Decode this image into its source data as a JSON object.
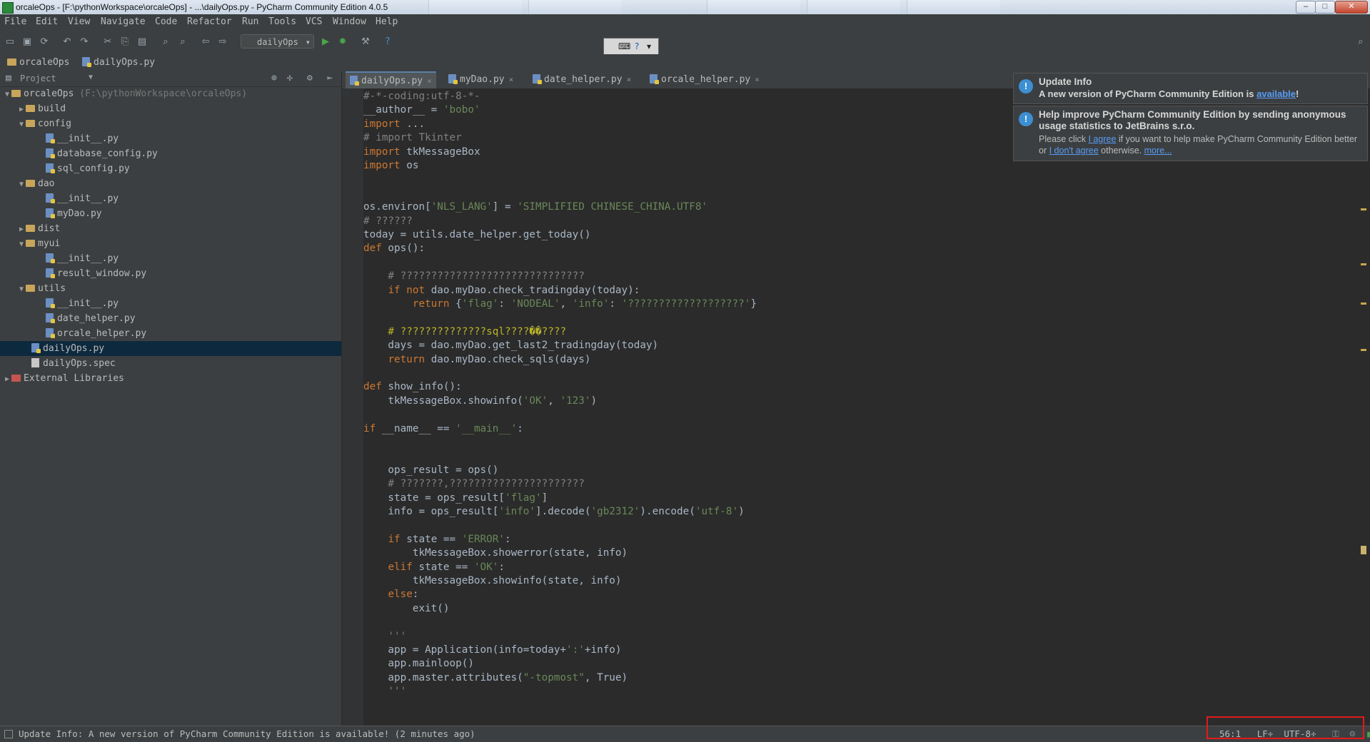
{
  "window": {
    "title": "orcaleOps - [F:\\pythonWorkspace\\orcaleOps] - ...\\dailyOps.py - PyCharm Community Edition 4.0.5",
    "controls": {
      "minimize": "–",
      "maximize": "□",
      "close": "✕"
    }
  },
  "menu": [
    "File",
    "Edit",
    "View",
    "Navigate",
    "Code",
    "Refactor",
    "Run",
    "Tools",
    "VCS",
    "Window",
    "Help"
  ],
  "toolbar": {
    "run_config": "dailyOps",
    "icons": [
      "open-icon",
      "save-icon",
      "sync-icon",
      "undo-icon",
      "redo-icon",
      "cut-icon",
      "copy-icon",
      "paste-icon",
      "find-icon",
      "replace-icon",
      "back-icon",
      "forward-icon",
      "run-icon",
      "debug-icon",
      "settings-icon",
      "help-icon"
    ],
    "search_icon": "search-icon"
  },
  "breadcrumb": [
    "orcaleOps",
    "dailyOps.py"
  ],
  "project_panel": {
    "header": "Project",
    "tree": [
      {
        "label": "orcaleOps",
        "path": "(F:\\pythonWorkspace\\orcaleOps)",
        "type": "folder",
        "level": 0,
        "toggle": "▼"
      },
      {
        "label": "build",
        "type": "folder",
        "level": 1,
        "toggle": "▶"
      },
      {
        "label": "config",
        "type": "folder",
        "level": 1,
        "toggle": "▼"
      },
      {
        "label": "__init__.py",
        "type": "py",
        "level": 2
      },
      {
        "label": "database_config.py",
        "type": "py",
        "level": 2
      },
      {
        "label": "sql_config.py",
        "type": "py",
        "level": 2
      },
      {
        "label": "dao",
        "type": "folder",
        "level": 1,
        "toggle": "▼"
      },
      {
        "label": "__init__.py",
        "type": "py",
        "level": 2
      },
      {
        "label": "myDao.py",
        "type": "py",
        "level": 2
      },
      {
        "label": "dist",
        "type": "folder",
        "level": 1,
        "toggle": "▶"
      },
      {
        "label": "myui",
        "type": "folder",
        "level": 1,
        "toggle": "▼"
      },
      {
        "label": "__init__.py",
        "type": "py",
        "level": 2
      },
      {
        "label": "result_window.py",
        "type": "py",
        "level": 2
      },
      {
        "label": "utils",
        "type": "folder",
        "level": 1,
        "toggle": "▼"
      },
      {
        "label": "__init__.py",
        "type": "py",
        "level": 2
      },
      {
        "label": "date_helper.py",
        "type": "py",
        "level": 2
      },
      {
        "label": "orcale_helper.py",
        "type": "py",
        "level": 2
      },
      {
        "label": "dailyOps.py",
        "type": "py",
        "level": 1,
        "selected": true
      },
      {
        "label": "dailyOps.spec",
        "type": "spec",
        "level": 1
      },
      {
        "label": "External Libraries",
        "type": "lib",
        "level": 0,
        "toggle": "▶"
      }
    ]
  },
  "editor_tabs": [
    {
      "label": "dailyOps.py",
      "active": true
    },
    {
      "label": "myDao.py"
    },
    {
      "label": "date_helper.py"
    },
    {
      "label": "orcale_helper.py"
    }
  ],
  "code_lines": [
    "#-*-coding:utf-8-*-",
    "__author__ = 'bobo'",
    "import ...",
    "# import Tkinter",
    "import tkMessageBox",
    "import os",
    "",
    "",
    "os.environ['NLS_LANG'] = 'SIMPLIFIED CHINESE_CHINA.UTF8'",
    "# ??????",
    "today = utils.date_helper.get_today()",
    "def ops():",
    "",
    "    # ??????????????????????????????",
    "    if not dao.myDao.check_tradingday(today):",
    "        return {'flag': 'NODEAL', 'info': '???????????????????'}",
    "",
    "    # ??????????????sql????��????",
    "    days = dao.myDao.get_last2_tradingday(today)",
    "    return dao.myDao.check_sqls(days)",
    "",
    "def show_info():",
    "    tkMessageBox.showinfo('OK', '123')",
    "",
    "if __name__ == '__main__':",
    "",
    "",
    "    ops_result = ops()",
    "    # ???????,??????????????????????",
    "    state = ops_result['flag']",
    "    info = ops_result['info'].decode('gb2312').encode('utf-8')",
    "",
    "    if state == 'ERROR':",
    "        tkMessageBox.showerror(state, info)",
    "    elif state == 'OK':",
    "        tkMessageBox.showinfo(state, info)",
    "    else:",
    "        exit()",
    "",
    "    '''",
    "    app = Application(info=today+':'+info)",
    "    app.mainloop()",
    "    app.master.attributes(\"-topmost\", True)",
    "    '''"
  ],
  "notifications": {
    "update": {
      "title": "Update Info",
      "text_before": "A new version of PyCharm Community Edition is ",
      "link": "available",
      "text_after": "!"
    },
    "stats": {
      "title": "Help improve PyCharm Community Edition by sending anonymous usage statistics to JetBrains s.r.o.",
      "t1": "Please click ",
      "agree": "I agree",
      "t2": " if you want to help make PyCharm Community Edition better or ",
      "disagree": "I don't agree",
      "t3": " otherwise. ",
      "more": "more..."
    }
  },
  "status": {
    "message": "Update Info: A new version of PyCharm Community Edition is available! (2 minutes ago)",
    "caret_position": "56:1",
    "line_separator": "LF",
    "encoding": "UTF-8"
  },
  "colors": {
    "keyword": "#cc7832",
    "string": "#6a8759",
    "comment": "#808080",
    "identifier": "#a9b7c6",
    "highlight_red": "#e01b1b"
  }
}
